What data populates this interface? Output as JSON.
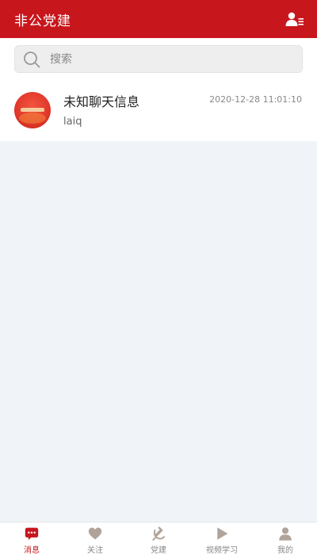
{
  "header": {
    "title": "非公党建",
    "contacts_icon": "contacts-icon"
  },
  "search": {
    "placeholder": "搜索",
    "icon": "search-icon"
  },
  "messages": [
    {
      "title": "未知聊天信息",
      "preview": "laiq",
      "time": "2020-12-28 11:01:10"
    }
  ],
  "tabs": [
    {
      "label": "消息",
      "icon": "chat-bubble-icon",
      "active": true
    },
    {
      "label": "关注",
      "icon": "heart-icon",
      "active": false
    },
    {
      "label": "党建",
      "icon": "party-emblem-icon",
      "active": false
    },
    {
      "label": "视频学习",
      "icon": "play-icon",
      "active": false
    },
    {
      "label": "我的",
      "icon": "user-icon",
      "active": false
    }
  ],
  "colors": {
    "brand": "#c8161d",
    "tab_inactive": "#b0a49a",
    "background": "#f0f4f8"
  }
}
